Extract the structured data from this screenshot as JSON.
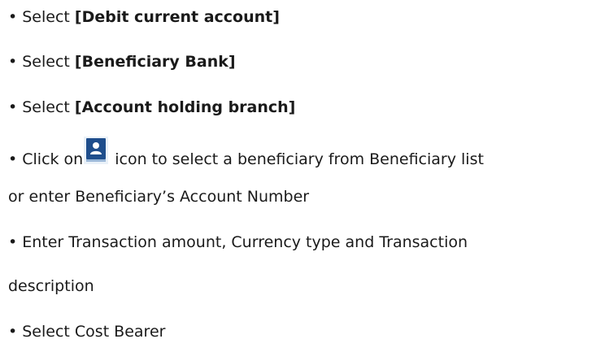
{
  "instructions": {
    "item1": {
      "prefix": "• Select ",
      "bold": "[Debit current account]"
    },
    "item2": {
      "prefix": "• Select ",
      "bold": "[Beneficiary Bank]"
    },
    "item3": {
      "prefix": "• Select ",
      "bold": "[Account holding branch]"
    },
    "item4": {
      "before_icon": "• Click on",
      "after_icon": "icon to select a beneficiary from Beneficiary list",
      "continuation": "or enter Beneficiary’s Account Number"
    },
    "item5": {
      "text": "• Enter Transaction amount, Currency type and Transaction",
      "continuation": "description"
    },
    "item6": {
      "text": "• Select Cost Bearer"
    }
  },
  "icon": {
    "name": "contact-book-icon",
    "color": "#1f4e8c"
  }
}
